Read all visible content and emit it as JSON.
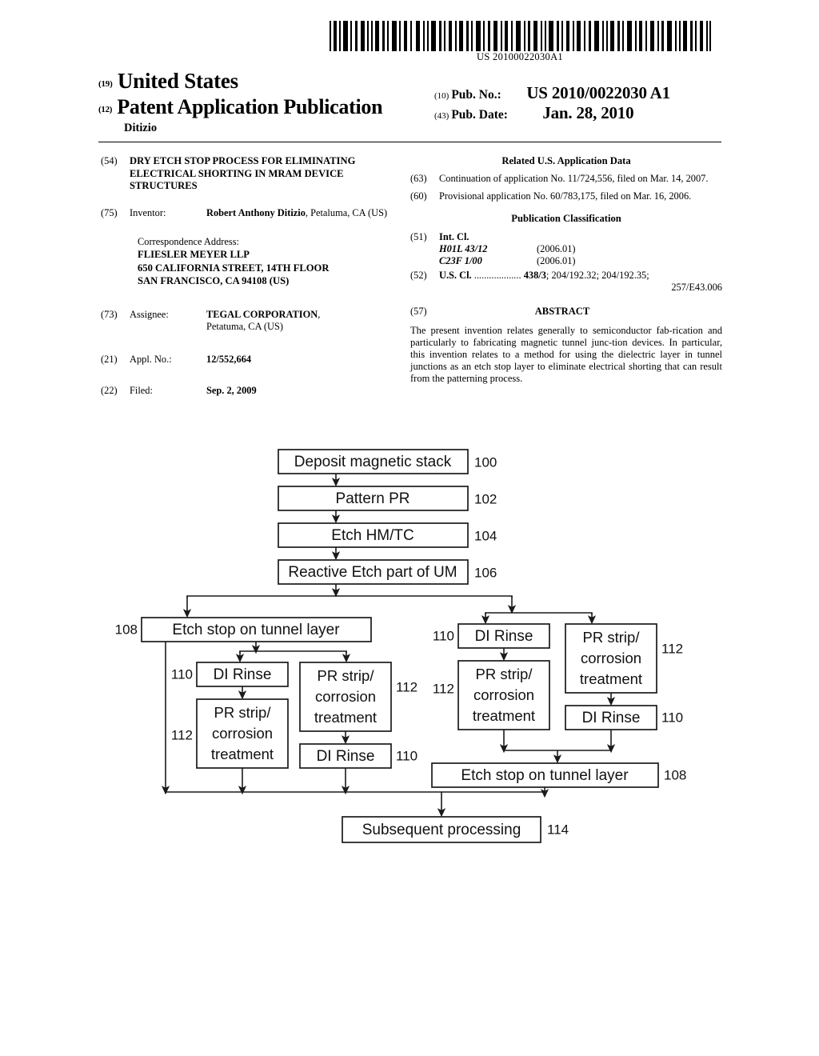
{
  "barcode": {
    "number": "US 20100022030A1",
    "icon": "barcode-icon"
  },
  "header": {
    "code_19": "(19)",
    "country": "United States",
    "code_12": "(12)",
    "doc_type": "Patent Application Publication",
    "author": "Ditizio",
    "pub_no_code": "(10)",
    "pub_no_label": "Pub. No.:",
    "pub_no_value": "US 2010/0022030 A1",
    "pub_date_code": "(43)",
    "pub_date_label": "Pub. Date:",
    "pub_date_value": "Jan. 28, 2010"
  },
  "left_column": {
    "title_code": "(54)",
    "title": "DRY ETCH STOP PROCESS FOR ELIMINATING ELECTRICAL SHORTING IN MRAM DEVICE STRUCTURES",
    "inventor_code": "(75)",
    "inventor_label": "Inventor:",
    "inventor_name": "Robert Anthony Ditizio",
    "inventor_rest": ", Petaluma, CA (US)",
    "correspondence_label": "Correspondence Address:",
    "correspondence_lines": [
      "FLIESLER MEYER LLP",
      "650 CALIFORNIA STREET, 14TH FLOOR",
      "SAN FRANCISCO, CA 94108 (US)"
    ],
    "assignee_code": "(73)",
    "assignee_label": "Assignee:",
    "assignee_name": "TEGAL CORPORATION",
    "assignee_rest": ",",
    "assignee_city": "Petatuma, CA (US)",
    "appl_code": "(21)",
    "appl_label": "Appl. No.:",
    "appl_value": "12/552,664",
    "filed_code": "(22)",
    "filed_label": "Filed:",
    "filed_value": "Sep. 2, 2009"
  },
  "right_column": {
    "related_head": "Related U.S. Application Data",
    "cont_code": "(63)",
    "cont_text": "Continuation of application No. 11/724,556, filed on Mar. 14, 2007.",
    "prov_code": "(60)",
    "prov_text": "Provisional application No. 60/783,175, filed on Mar. 16, 2006.",
    "pubclass_head": "Publication Classification",
    "intcl_code": "(51)",
    "intcl_label": "Int. Cl.",
    "intcl_entries": [
      {
        "code": "H01L 43/12",
        "year": "(2006.01)"
      },
      {
        "code": "C23F  1/00",
        "year": "(2006.01)"
      }
    ],
    "uscl_code": "(52)",
    "uscl_label": "U.S. Cl.",
    "uscl_dots": " ...................",
    "uscl_bold": "438/3",
    "uscl_rest": "; 204/192.32; 204/192.35;",
    "uscl_tail": "257/E43.006",
    "abstract_code": "(57)",
    "abstract_head": "ABSTRACT",
    "abstract_text": "The present invention relates generally to semiconductor fab‐rication and particularly to fabricating magnetic tunnel junc‐tion devices. In particular, this invention relates to a method for using the dielectric layer in tunnel junctions as an etch stop layer to eliminate electrical shorting that can result from the patterning process."
  },
  "figure": {
    "nodes": {
      "deposit": {
        "label": "Deposit magnetic stack",
        "ref": "100"
      },
      "pattern_pr": {
        "label": "Pattern PR",
        "ref": "102"
      },
      "etch_hm_tc": {
        "label": "Etch HM/TC",
        "ref": "104"
      },
      "reactive_etch": {
        "label": "Reactive Etch part of UM",
        "ref": "106"
      },
      "left_etch_stop": {
        "label": "Etch stop on tunnel layer",
        "ref": "108"
      },
      "left_a_di": {
        "label": "DI Rinse",
        "ref": "110"
      },
      "left_a_pr": {
        "label_1": "PR strip/",
        "label_2": "corrosion",
        "label_3": "treatment",
        "ref": "112"
      },
      "left_b_pr": {
        "label_1": "PR strip/",
        "label_2": "corrosion",
        "label_3": "treatment",
        "ref": "112"
      },
      "left_b_di": {
        "label": "DI Rinse",
        "ref": "110"
      },
      "right_a_di": {
        "label": "DI Rinse",
        "ref": "110"
      },
      "right_a_pr": {
        "label_1": "PR strip/",
        "label_2": "corrosion",
        "label_3": "treatment",
        "ref": "112"
      },
      "right_b_pr": {
        "label_1": "PR strip/",
        "label_2": "corrosion",
        "label_3": "treatment",
        "ref": "112"
      },
      "right_b_di": {
        "label": "DI Rinse",
        "ref": "110"
      },
      "right_etch_stop": {
        "label": "Etch stop on tunnel layer",
        "ref": "108"
      },
      "subsequent": {
        "label": "Subsequent processing",
        "ref": "114"
      }
    }
  }
}
